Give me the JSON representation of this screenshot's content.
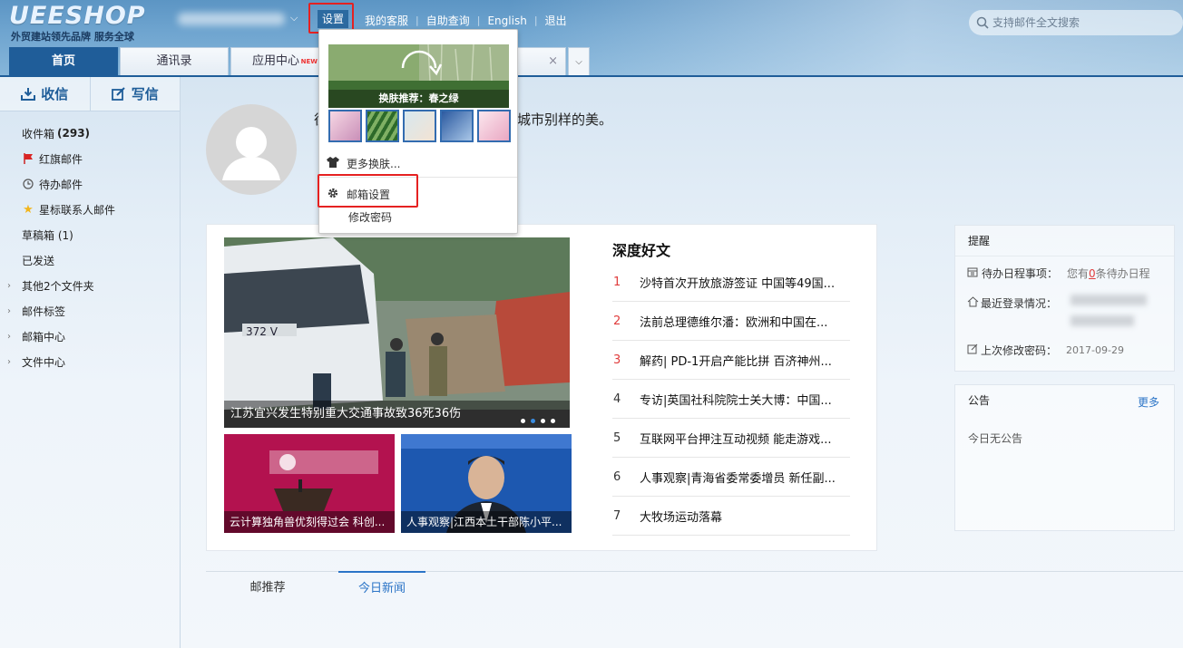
{
  "header": {
    "logo": "UEESHOP",
    "slogan": "外贸建站领先品牌 服务全球",
    "nav": [
      "设置",
      "我的客服",
      "自助查询",
      "English",
      "退出"
    ],
    "search_placeholder": "支持邮件全文搜索"
  },
  "tabs": {
    "items": [
      "首页",
      "通讯录",
      "应用中心"
    ],
    "new_badge": "NEW",
    "close": "×"
  },
  "sidebar": {
    "receive": "收信",
    "compose": "写信",
    "folders": [
      {
        "label": "收件箱",
        "count": "(293)"
      },
      {
        "label": "红旗邮件"
      },
      {
        "label": "待办邮件"
      },
      {
        "label": "星标联系人邮件"
      },
      {
        "label": "草稿箱 (1)"
      },
      {
        "label": "已发送"
      },
      {
        "label": "其他2个文件夹"
      },
      {
        "label": "邮件标签"
      },
      {
        "label": "邮箱中心"
      },
      {
        "label": "文件中心"
      }
    ]
  },
  "profile": {
    "line_start": "往",
    "line_end": "城市别样的美。"
  },
  "news": {
    "main_caption": "江苏宜兴发生特别重大交通事故致36死36伤",
    "small_captions": [
      "云计算独角兽优刻得过会 科创...",
      "人事观察|江西本土干部陈小平..."
    ],
    "deep_title": "深度好文",
    "articles": [
      {
        "num": "1",
        "title": "沙特首次开放旅游签证 中国等49国..."
      },
      {
        "num": "2",
        "title": "法前总理德维尔潘：欧洲和中国在..."
      },
      {
        "num": "3",
        "title": "解药| PD-1开启产能比拼 百济神州..."
      },
      {
        "num": "4",
        "title": "专访|英国社科院院士关大博：中国..."
      },
      {
        "num": "5",
        "title": "互联网平台押注互动视频 能走游戏..."
      },
      {
        "num": "6",
        "title": "人事观察|青海省委常委增员 新任副..."
      },
      {
        "num": "7",
        "title": "大牧场运动落幕"
      }
    ]
  },
  "reminder": {
    "title": "提醒",
    "todo_label": "待办日程事项：",
    "todo_value_pre": "您有",
    "todo_count": "0",
    "todo_value_post": "条待办日程",
    "last_login_label": "最近登录情况：",
    "last_pwd_label": "上次修改密码：",
    "last_pwd_value": "2017-09-29"
  },
  "notice": {
    "title": "公告",
    "more": "更多",
    "empty": "今日无公告"
  },
  "bottom_tabs": [
    "邮推荐",
    "今日新闻"
  ],
  "dropdown": {
    "skin_caption": "换肤推荐：春之绿",
    "more_skins": "更多换肤...",
    "mailbox_settings": "邮箱设置",
    "change_password": "修改密码"
  },
  "colors": {
    "accent": "#1f5d99",
    "link": "#2b74c7",
    "highlight_red": "#e52121",
    "hot_number": "#e03c3c"
  }
}
